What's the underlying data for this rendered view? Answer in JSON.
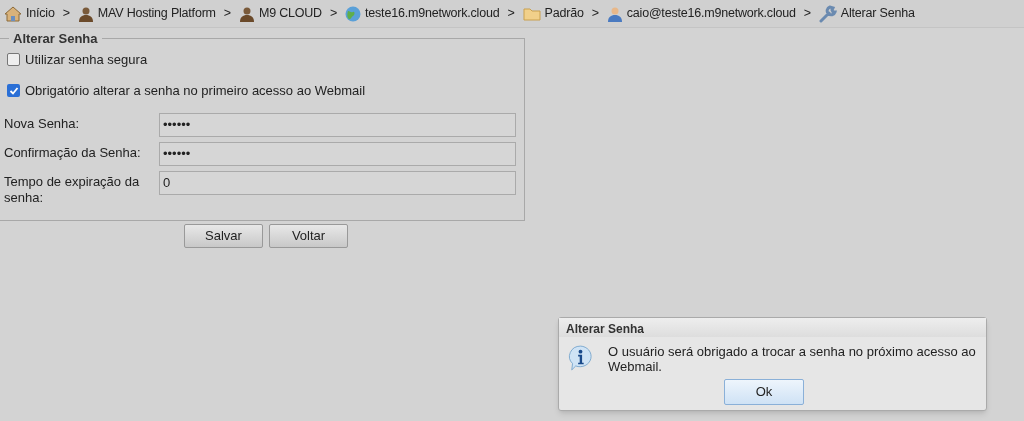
{
  "breadcrumb": [
    {
      "kind": "house",
      "label": "Início",
      "separator": ">"
    },
    {
      "kind": "person",
      "label": "MAV Hosting Platform",
      "separator": ">"
    },
    {
      "kind": "person",
      "label": "M9 CLOUD",
      "separator": ">"
    },
    {
      "kind": "globe",
      "label": "teste16.m9network.cloud",
      "separator": ">"
    },
    {
      "kind": "folder",
      "label": "Padrão",
      "separator": ">"
    },
    {
      "kind": "user",
      "label": "caio@teste16.m9network.cloud",
      "separator": ">"
    },
    {
      "kind": "wrench",
      "label": "Alterar Senha"
    }
  ],
  "form": {
    "legend": "Alterar Senha",
    "checkboxes": [
      {
        "label": "Utilizar senha segura",
        "checked": false
      },
      {
        "label": "Obrigatório alterar a senha no primeiro acesso ao Webmail",
        "checked": true
      }
    ],
    "fields": [
      {
        "label": "Nova Senha:",
        "value": "••••••"
      },
      {
        "label": "Confirmação da Senha:",
        "value": "••••••"
      },
      {
        "label": "Tempo de expiração da senha:",
        "value": "0"
      }
    ],
    "buttons": [
      "Salvar",
      "Voltar"
    ]
  },
  "dialog": {
    "title": "Alterar Senha",
    "message": "O usuário será obrigado a trocar a senha no próximo acesso ao Webmail.",
    "button": "Ok"
  }
}
